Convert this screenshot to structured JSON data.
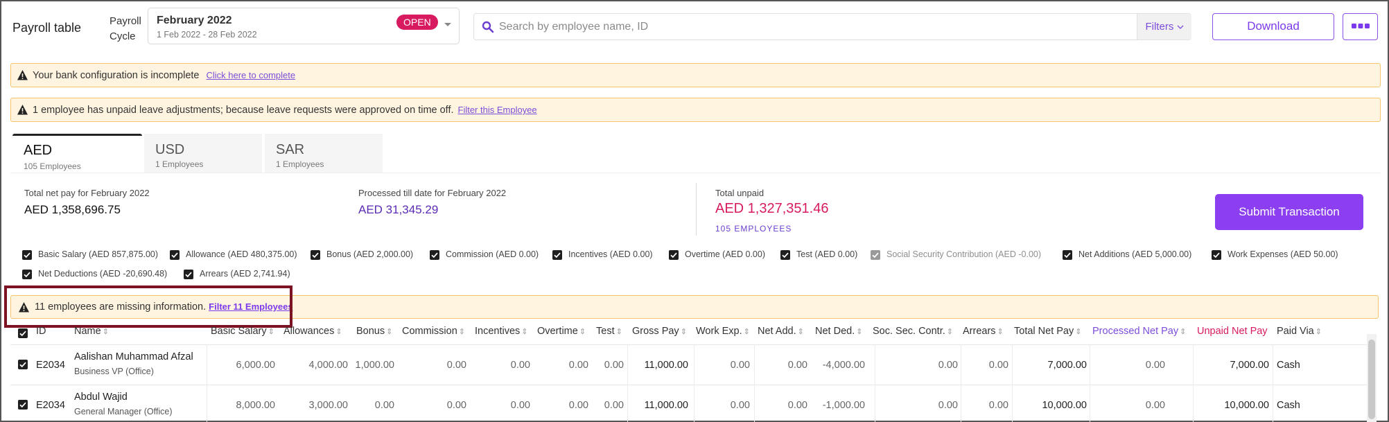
{
  "header": {
    "title": "Payroll table",
    "cycle_label": "Payroll Cycle",
    "cycle_month": "February 2022",
    "cycle_range": "1 Feb 2022 - 28 Feb 2022",
    "cycle_status": "OPEN",
    "search_placeholder": "Search by employee name, ID",
    "filters_label": "Filters",
    "download_label": "Download"
  },
  "alerts": {
    "bank": {
      "text": "Your bank configuration is incomplete",
      "link": "Click here to complete"
    },
    "leave": {
      "text": "1 employee has unpaid leave adjustments; because leave requests were approved on time off.",
      "link": "Filter this Employee"
    },
    "missing": {
      "text": "11 employees are missing information.",
      "link": "Filter 11 Employees"
    }
  },
  "currency_tabs": [
    {
      "code": "AED",
      "employees": "105 Employees"
    },
    {
      "code": "USD",
      "employees": "1 Employees"
    },
    {
      "code": "SAR",
      "employees": "1 Employees"
    }
  ],
  "summary": {
    "total_label": "Total net pay for February 2022",
    "total_value": "AED 1,358,696.75",
    "processed_label": "Processed till date for February 2022",
    "processed_value": "AED 31,345.29",
    "unpaid_label": "Total unpaid",
    "unpaid_value": "AED 1,327,351.46",
    "unpaid_employees": "105 EMPLOYEES",
    "submit_label": "Submit Transaction"
  },
  "components": [
    {
      "label": "Basic Salary (AED 857,875.00)"
    },
    {
      "label": "Allowance (AED 480,375.00)"
    },
    {
      "label": "Bonus (AED 2,000.00)"
    },
    {
      "label": "Commission (AED 0.00)"
    },
    {
      "label": "Incentives (AED 0.00)"
    },
    {
      "label": "Overtime (AED 0.00)"
    },
    {
      "label": "Test (AED 0.00)"
    },
    {
      "label": "Social Security Contribution (AED -0.00)"
    },
    {
      "label": "Net Additions (AED 5,000.00)"
    },
    {
      "label": "Work Expenses (AED 50.00)"
    },
    {
      "label": "Net Deductions (AED -20,690.48)"
    },
    {
      "label": "Arrears (AED 2,741.94)"
    }
  ],
  "table": {
    "headers": [
      "ID",
      "Name",
      "Basic Salary",
      "Allowances",
      "Bonus",
      "Commission",
      "Incentives",
      "Overtime",
      "Test",
      "Gross Pay",
      "Work Exp.",
      "Net Add.",
      "Net Ded.",
      "Soc. Sec. Contr.",
      "Arrears",
      "Total Net Pay",
      "Processed Net Pay",
      "Unpaid Net Pay",
      "Paid Via"
    ],
    "rows": [
      {
        "id": "E2034",
        "name": "Aalishan Muhammad Afzal",
        "role": "Business VP (Office)",
        "values": [
          "6,000.00",
          "4,000.00",
          "1,000.00",
          "0.00",
          "0.00",
          "0.00",
          "0.00",
          "11,000.00",
          "0.00",
          "0.00",
          "-4,000.00",
          "0.00",
          "0.00",
          "7,000.00",
          "0.00",
          "7,000.00",
          "Cash"
        ]
      },
      {
        "id": "E2034",
        "name": "Abdul Wajid",
        "role": "General Manager (Office)",
        "values": [
          "8,000.00",
          "3,000.00",
          "0.00",
          "0.00",
          "0.00",
          "0.00",
          "0.00",
          "11,000.00",
          "0.00",
          "0.00",
          "-1,000.00",
          "0.00",
          "0.00",
          "10,000.00",
          "0.00",
          "10,000.00",
          "Cash"
        ]
      }
    ]
  },
  "colors": {
    "accent": "#8b3ff0",
    "pink": "#d81b60",
    "warning_bg": "#fff4df",
    "highlight": "#7b1322"
  },
  "icons": [
    "chevron-down-icon",
    "search-icon",
    "chevron-down-small-icon",
    "more-dots-icon",
    "warning-icon",
    "checkbox-checked-icon",
    "sort-icon"
  ]
}
